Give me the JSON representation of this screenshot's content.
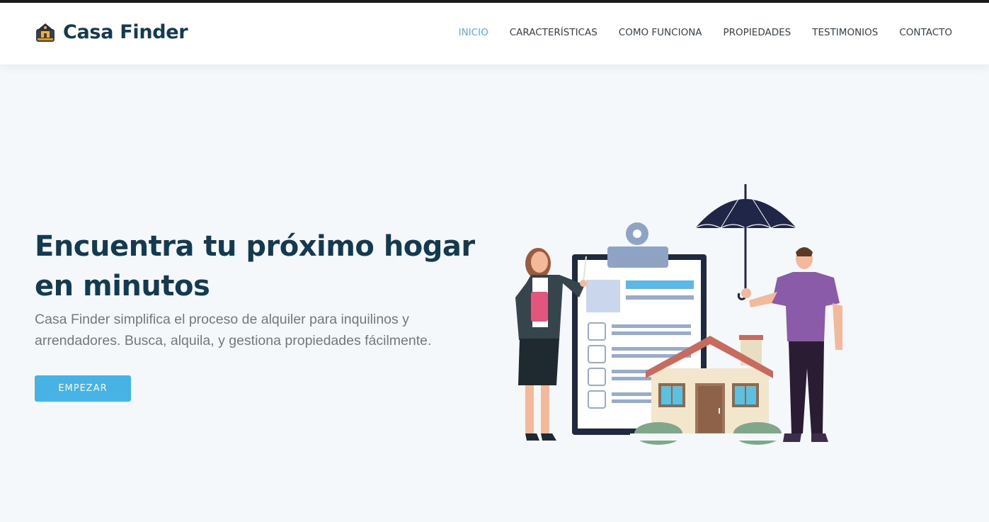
{
  "brand": {
    "name": "Casa Finder",
    "logo_icon": "house-badge-icon"
  },
  "nav": {
    "items": [
      {
        "label": "INICIO",
        "active": true
      },
      {
        "label": "CARACTERÍSTICAS",
        "active": false
      },
      {
        "label": "COMO FUNCIONA",
        "active": false
      },
      {
        "label": "PROPIEDADES",
        "active": false
      },
      {
        "label": "TESTIMONIOS",
        "active": false
      },
      {
        "label": "CONTACTO",
        "active": false
      }
    ]
  },
  "hero": {
    "title": "Encuentra tu próximo hogar en minutos",
    "subtitle": "Casa Finder simplifica el proceso de alquiler para inquilinos y arrendadores. Busca, alquila, y gestiona propiedades fácilmente.",
    "cta_label": "EMPEZAR",
    "illustration_icon": "rental-house-illustration-icon"
  },
  "colors": {
    "accent": "#47b2e4",
    "heading": "#123a50",
    "background": "#f4f8fb",
    "text_muted": "#72787d"
  }
}
